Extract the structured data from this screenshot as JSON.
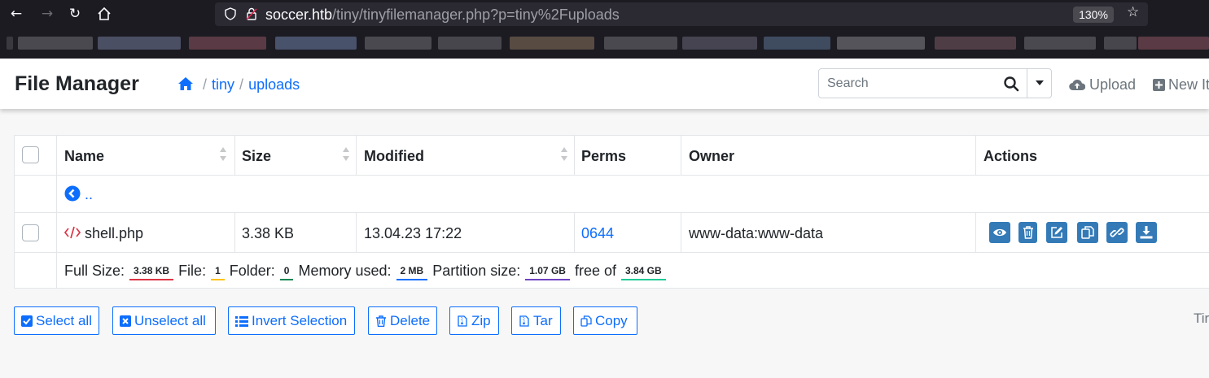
{
  "browser": {
    "url_host": "soccer.htb",
    "url_path": "/tiny/tinyfilemanager.php?p=tiny%2Fuploads",
    "zoom": "130%"
  },
  "app": {
    "brand": "File Manager",
    "breadcrumb": [
      "tiny",
      "uploads"
    ],
    "search_placeholder": "Search",
    "upload_label": "Upload",
    "new_item_label": "New It"
  },
  "table": {
    "headers": {
      "name": "Name",
      "size": "Size",
      "modified": "Modified",
      "perms": "Perms",
      "owner": "Owner",
      "actions": "Actions"
    },
    "parent_label": "..",
    "files": [
      {
        "name": "shell.php",
        "size": "3.38 KB",
        "modified": "13.04.23 17:22",
        "perms": "0644",
        "owner": "www-data:www-data"
      }
    ],
    "stats": {
      "full_size_label": "Full Size:",
      "full_size": "3.38 KB",
      "file_label": "File:",
      "file_count": "1",
      "folder_label": "Folder:",
      "folder_count": "0",
      "memory_label": "Memory used:",
      "memory": "2 MB",
      "partition_label": "Partition size:",
      "partition": "1.07 GB",
      "free_label": "free of",
      "free": "3.84 GB"
    }
  },
  "buttons": {
    "select_all": "Select all",
    "unselect_all": "Unselect all",
    "invert": "Invert Selection",
    "delete": "Delete",
    "zip": "Zip",
    "tar": "Tar",
    "copy": "Copy"
  },
  "footer_text": "Tir",
  "colors": {
    "primary": "#0d6efd",
    "action_button": "#337ab7",
    "badge_size": "#dc3545",
    "badge_file": "#ffc107",
    "badge_folder": "#198754",
    "badge_memory": "#0d6efd",
    "badge_partition": "#6f42c1",
    "badge_free": "#20c997"
  }
}
